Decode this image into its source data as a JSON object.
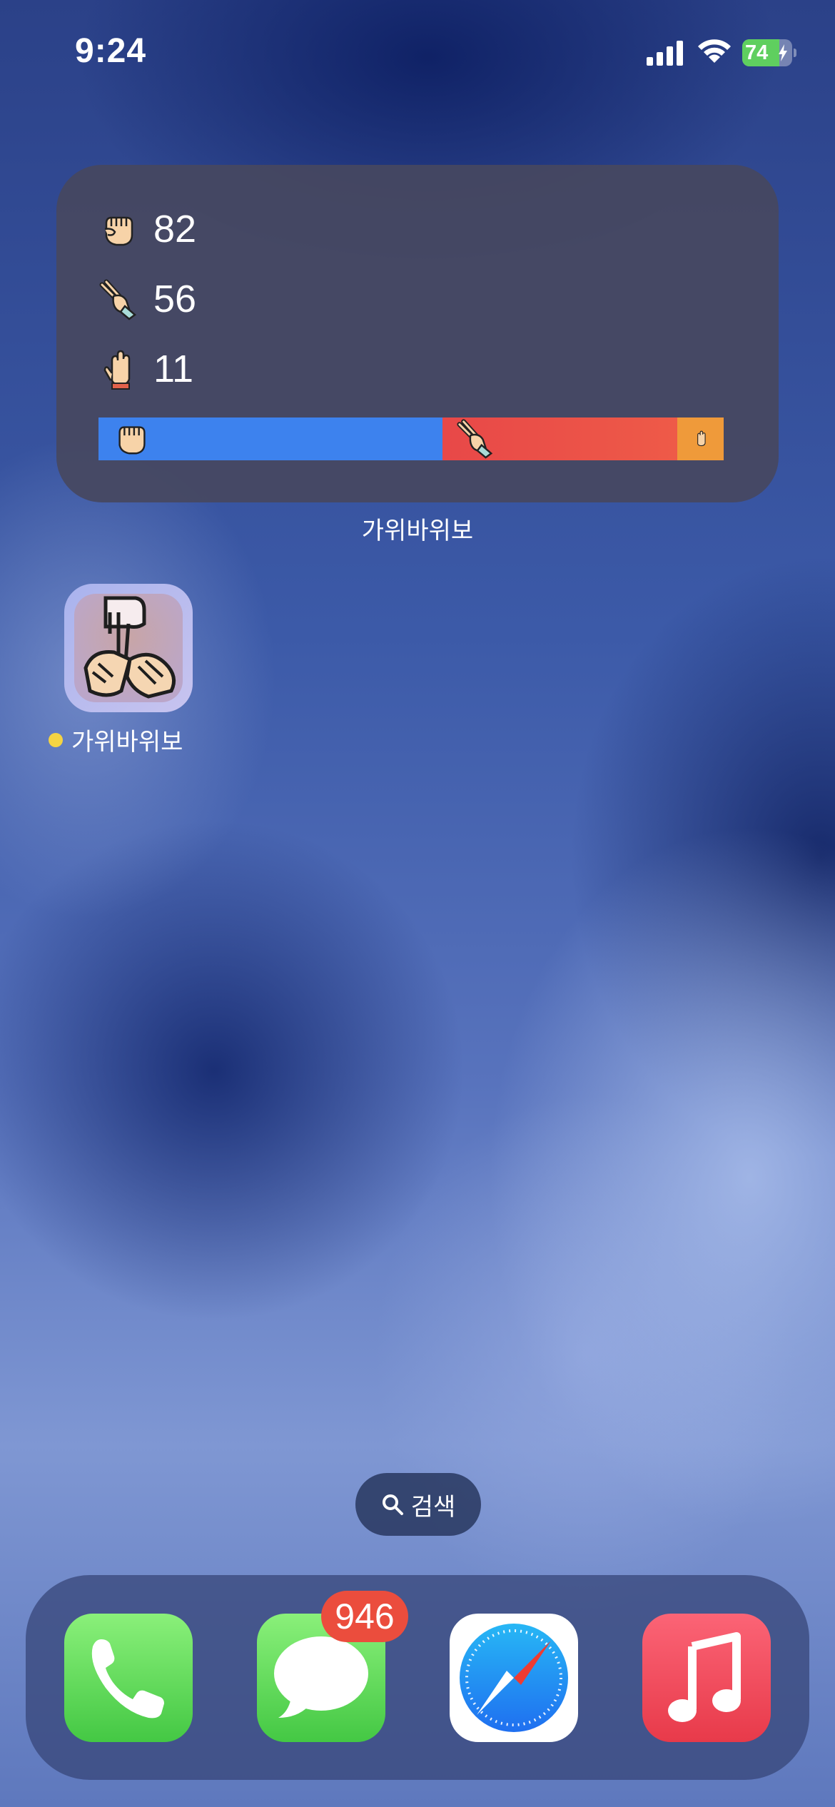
{
  "status_bar": {
    "time": "9:24",
    "battery_percent": 74,
    "battery_label": "74",
    "charging": true
  },
  "widget": {
    "stats": [
      {
        "icon": "rock-hand-icon",
        "count": "82"
      },
      {
        "icon": "scissors-hand-icon",
        "count": "56"
      },
      {
        "icon": "paper-hand-icon",
        "count": "11"
      }
    ],
    "bar": [
      {
        "icon": "rock-hand-icon",
        "value": 82,
        "color": "#3d82ee"
      },
      {
        "icon": "scissors-hand-icon",
        "value": 56,
        "color": "#e8504a"
      },
      {
        "icon": "paper-hand-icon",
        "value": 11,
        "color": "#ef9a3a"
      }
    ],
    "label": "가위바위보"
  },
  "app": {
    "name": "가위바위보",
    "new_dot_color": "#f5d442"
  },
  "search": {
    "label": "검색"
  },
  "dock": {
    "apps": [
      {
        "name": "phone",
        "icon": "phone-icon",
        "color": "#5fd45c"
      },
      {
        "name": "messages",
        "icon": "messages-icon",
        "color": "#5fd45c",
        "badge": "946"
      },
      {
        "name": "safari",
        "icon": "safari-icon",
        "color": "#2f7bf0"
      },
      {
        "name": "music",
        "icon": "music-icon",
        "color": "#f24b5b"
      }
    ]
  }
}
